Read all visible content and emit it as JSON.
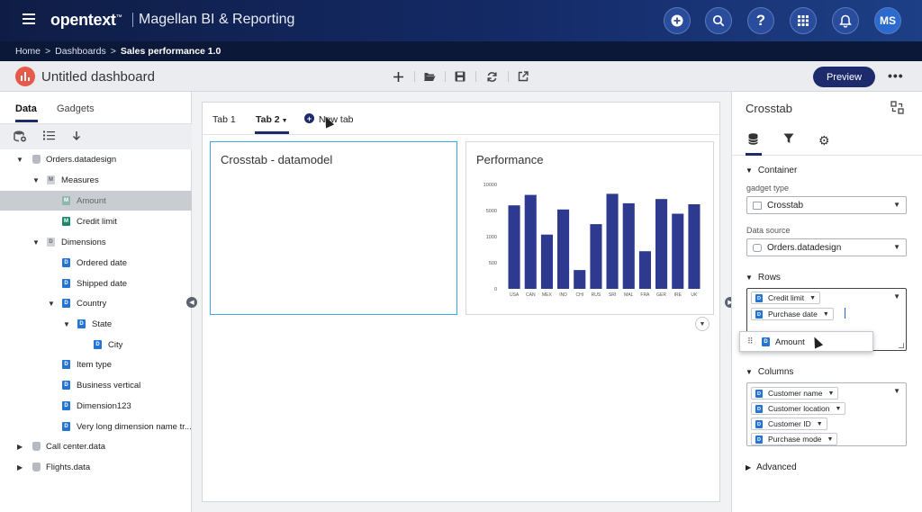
{
  "header": {
    "brand": "opentext",
    "brand_tm": "™",
    "product": "Magellan BI & Reporting",
    "icons": [
      "add-icon",
      "search-icon",
      "help-icon",
      "apps-icon",
      "bell-icon"
    ],
    "avatar": "MS"
  },
  "breadcrumb": {
    "items": [
      "Home",
      "Dashboards"
    ],
    "sep": ">",
    "current": "Sales performance 1.0"
  },
  "dashboard": {
    "title": "Untitled dashboard",
    "preview_label": "Preview",
    "more_label": "•••",
    "accent": "#e55a4b"
  },
  "left_panel": {
    "tabs": [
      "Data",
      "Gadgets"
    ],
    "active_tab": "Data",
    "tree": [
      {
        "label": "Orders.datadesign",
        "icon": "database-icon",
        "level": 0,
        "expanded": true
      },
      {
        "label": "Measures",
        "icon": "folder-icon",
        "level": 1,
        "expanded": true
      },
      {
        "label": "Amount",
        "icon": "measure-icon",
        "level": 2,
        "selected": true
      },
      {
        "label": "Credit limit",
        "icon": "measure-icon",
        "level": 2
      },
      {
        "label": "Dimensions",
        "icon": "folder-icon",
        "level": 1,
        "expanded": true
      },
      {
        "label": "Ordered date",
        "icon": "dimension-icon",
        "level": 2
      },
      {
        "label": "Shipped date",
        "icon": "dimension-icon",
        "level": 2
      },
      {
        "label": "Country",
        "icon": "dimension-icon",
        "level": 2,
        "expanded": true
      },
      {
        "label": "State",
        "icon": "dimension-icon",
        "level": 3,
        "expanded": true
      },
      {
        "label": "City",
        "icon": "dimension-icon",
        "level": 4
      },
      {
        "label": "Item type",
        "icon": "dimension-icon",
        "level": 2
      },
      {
        "label": "Business vertical",
        "icon": "dimension-icon",
        "level": 2
      },
      {
        "label": "Dimension123",
        "icon": "dimension-icon",
        "level": 2
      },
      {
        "label": "Very long dimension name tr...",
        "icon": "dimension-icon",
        "level": 2
      },
      {
        "label": "Call center.data",
        "icon": "database-icon",
        "level": 0,
        "expanded": false
      },
      {
        "label": "Flights.data",
        "icon": "database-icon",
        "level": 0,
        "expanded": false
      }
    ]
  },
  "canvas": {
    "tabs": [
      "Tab 1",
      "Tab 2"
    ],
    "active_tab": "Tab 2",
    "new_tab_label": "New tab",
    "gadgets": {
      "crosstab_title": "Crosstab - datamodel",
      "performance_title": "Performance"
    }
  },
  "chart_data": {
    "type": "bar",
    "title": "Performance",
    "categories": [
      "USA",
      "CAN",
      "MEX",
      "IND",
      "CHI",
      "RUS",
      "SRI",
      "MAL",
      "FRA",
      "GER",
      "IRE",
      "UK"
    ],
    "values": [
      8000,
      9000,
      5200,
      7600,
      1800,
      6200,
      9100,
      8200,
      3600,
      8600,
      7200,
      8100
    ],
    "ylim": [
      0,
      10000
    ],
    "yticks": [
      0,
      500,
      1000,
      5000,
      10000
    ],
    "bar_color": "#2e3a8f"
  },
  "right_panel": {
    "title": "Crosstab",
    "tab_icons": [
      "data-icon",
      "filter-icon",
      "settings-icon"
    ],
    "container": {
      "heading": "Container",
      "gadget_type_label": "gadget type",
      "gadget_type_value": "Crosstab",
      "data_source_label": "Data source",
      "data_source_value": "Orders.datadesign"
    },
    "rows": {
      "heading": "Rows",
      "chips": [
        "Credit limit",
        "Purchase date"
      ]
    },
    "drag_chip": "Amount",
    "columns": {
      "heading": "Columns",
      "chips": [
        "Customer name",
        "Customer location",
        "Customer ID",
        "Purchase mode"
      ]
    },
    "advanced_heading": "Advanced"
  }
}
